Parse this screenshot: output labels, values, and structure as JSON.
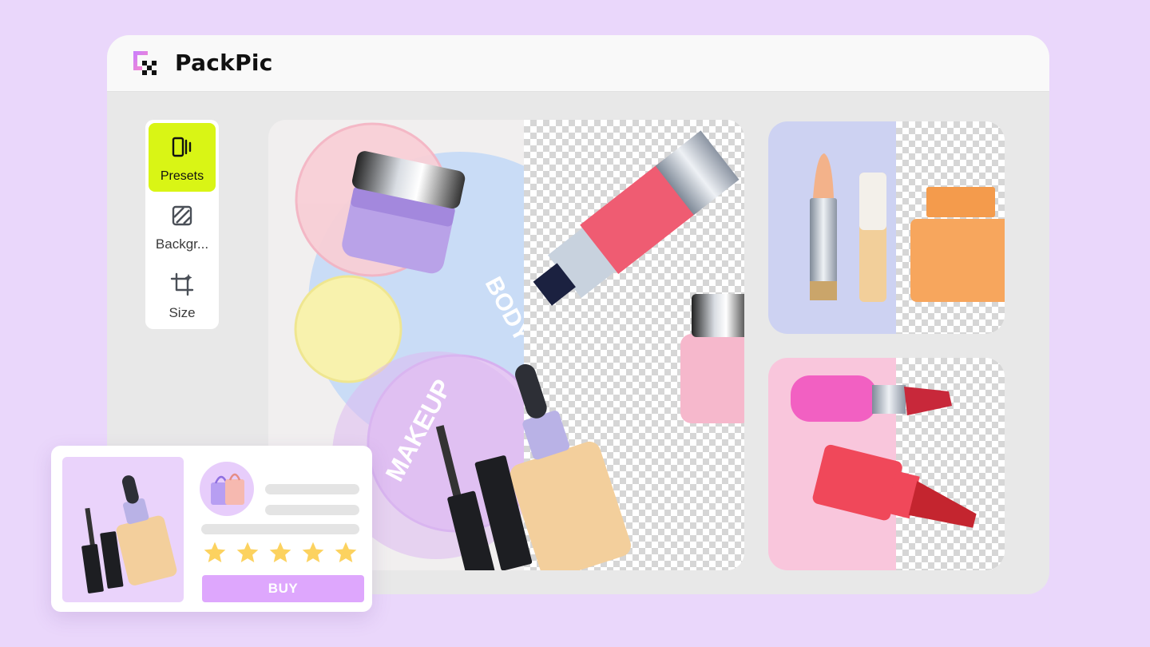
{
  "app": {
    "title": "PackPic",
    "logo_icon": "packpic-logo-icon",
    "brand_color": "#c77dff"
  },
  "tools": [
    {
      "label": "Presets",
      "icon": "presets-icon",
      "active": true
    },
    {
      "label": "Backgr...",
      "icon": "background-icon",
      "active": false
    },
    {
      "label": "Size",
      "icon": "crop-icon",
      "active": false
    }
  ],
  "canvas": {
    "text_body": "BODY",
    "text_makeup": "MAKEUP",
    "transparent_pattern": "checkerboard"
  },
  "thumbnails": [
    {
      "subject": "lipstick-and-perfume",
      "bg_color": "#cdd2f2"
    },
    {
      "subject": "red-lipsticks",
      "bg_color": "#f9c6dc"
    }
  ],
  "product_card": {
    "avatar_icon": "shopping-bags-icon",
    "rating": 5,
    "rating_max": 5,
    "buy_label": "BUY",
    "buy_color": "#dea7fd",
    "star_color": "#fcd25f"
  }
}
